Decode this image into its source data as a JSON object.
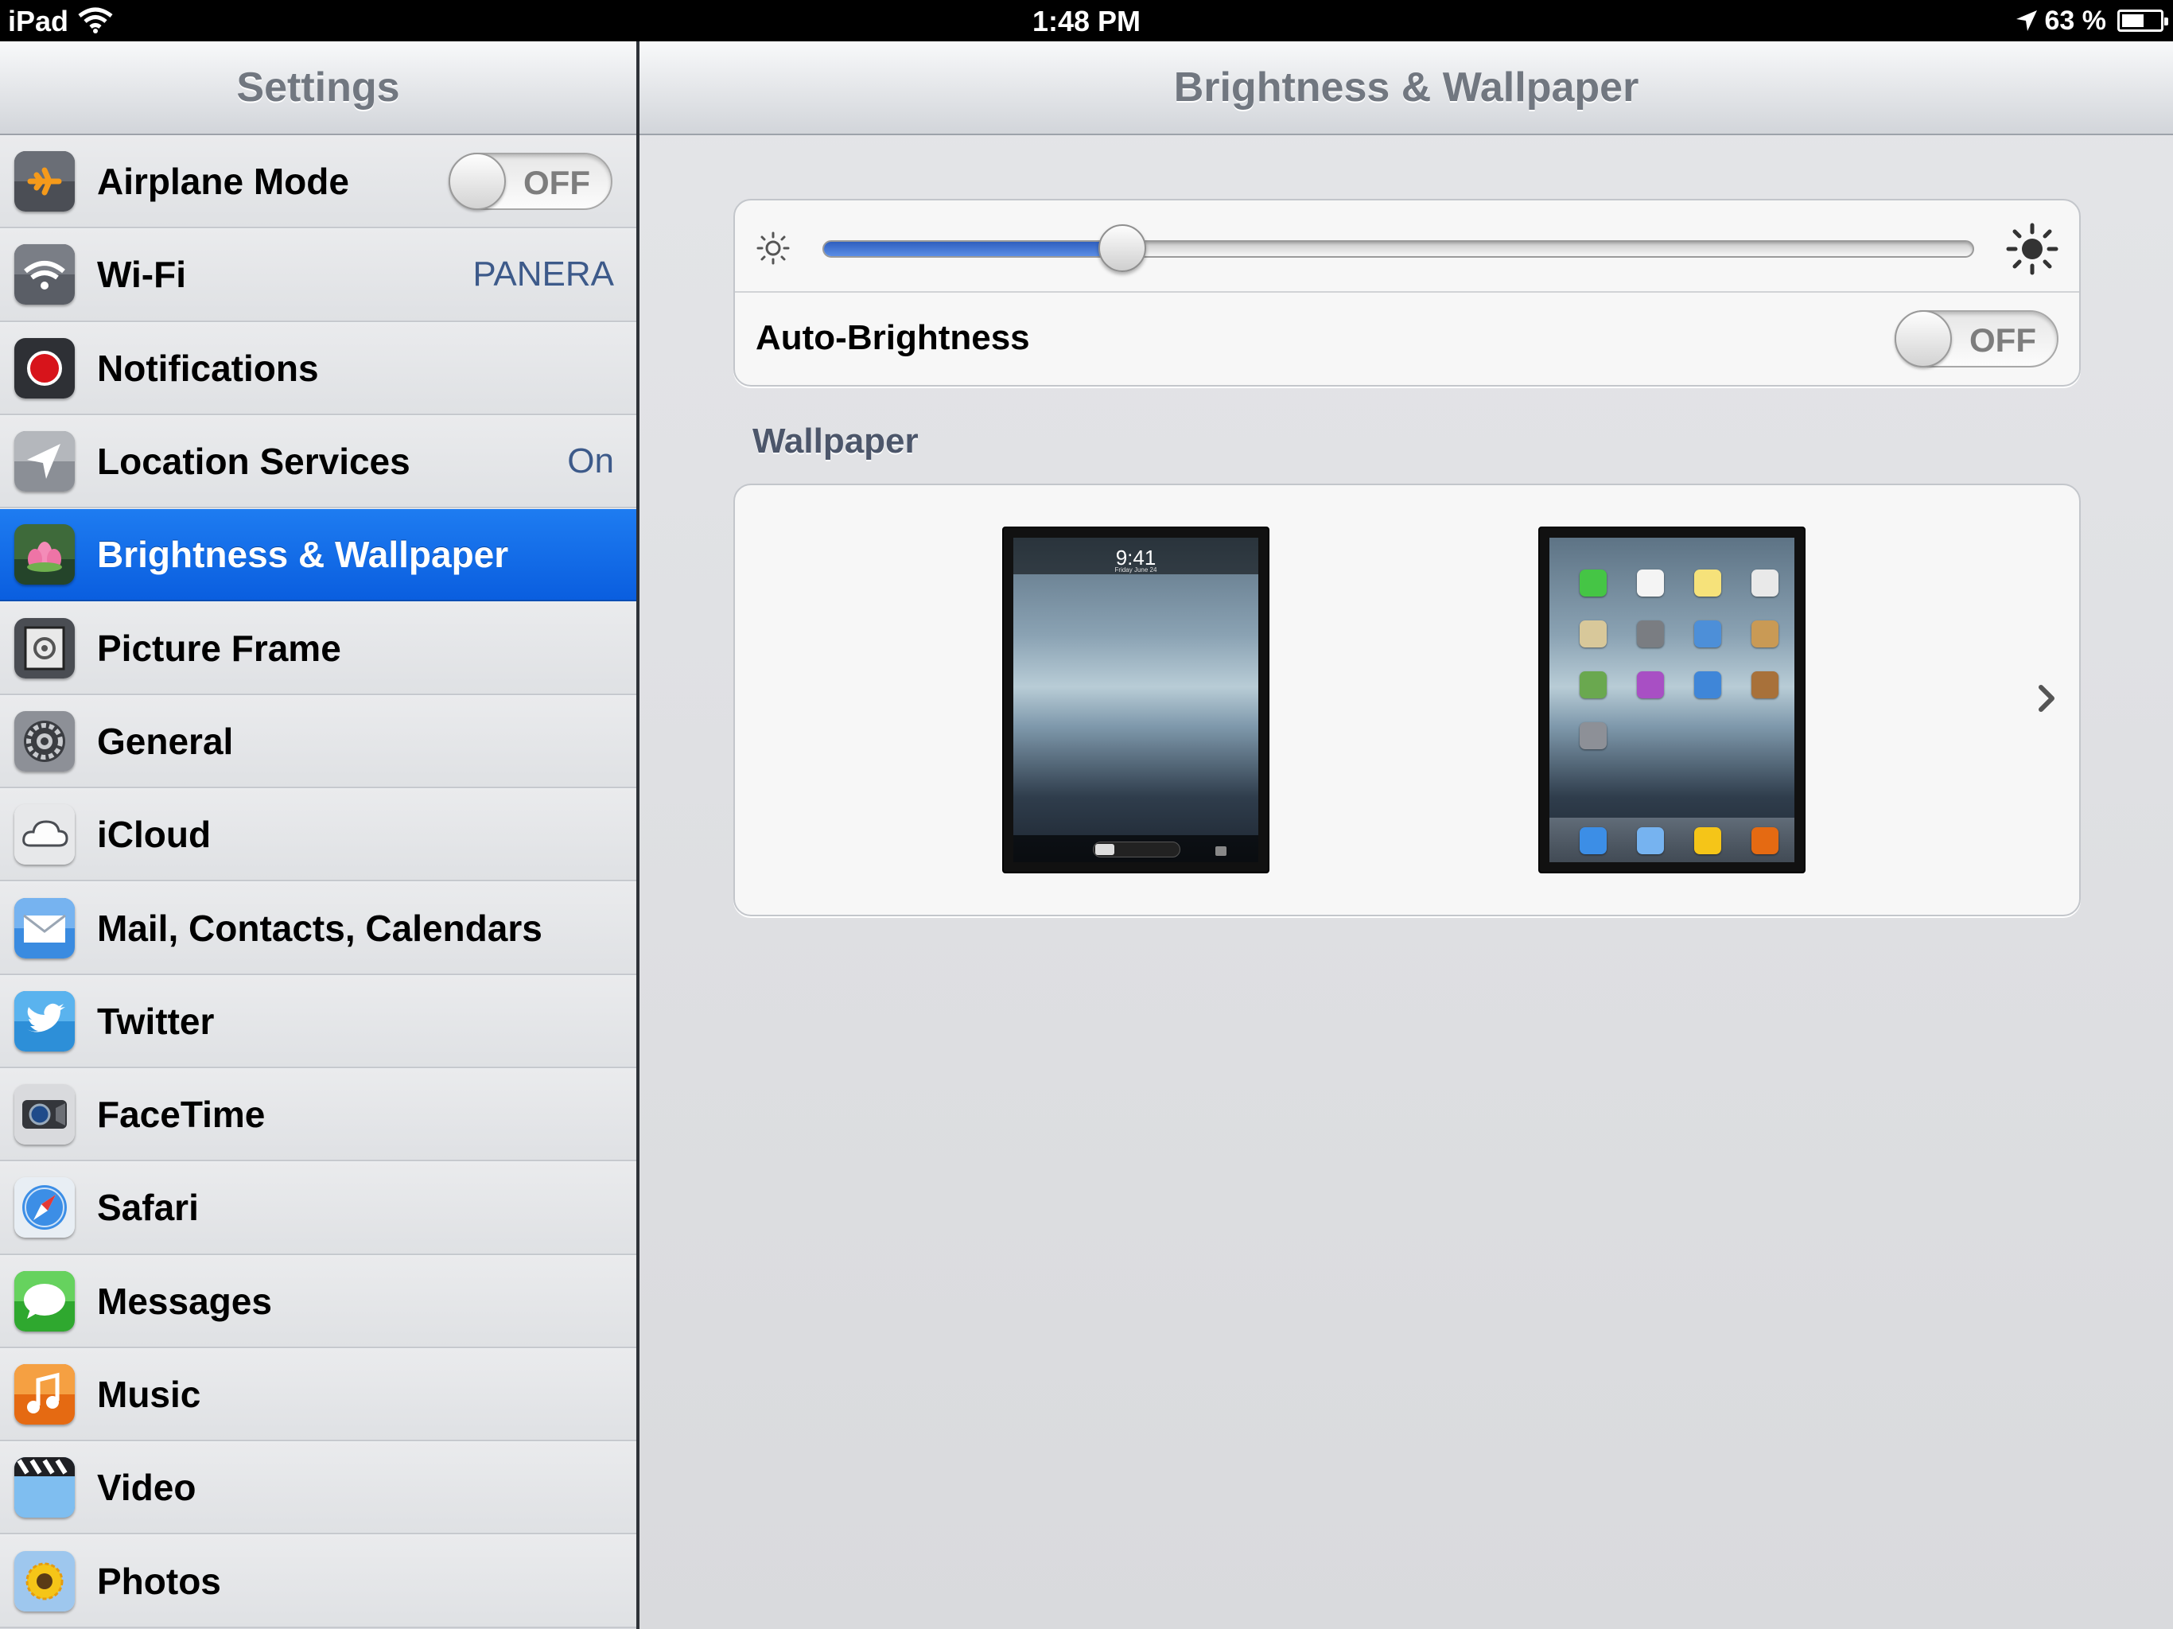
{
  "status_bar": {
    "carrier": "iPad",
    "time": "1:48 PM",
    "battery_percent_label": "63 %",
    "battery_level": 0.63,
    "icons": [
      "wifi-icon",
      "location-arrow-icon",
      "battery-icon"
    ]
  },
  "sidebar": {
    "title": "Settings",
    "items": [
      {
        "label": "Airplane Mode",
        "icon": "airplane-icon",
        "toggle": "OFF",
        "value": null
      },
      {
        "label": "Wi-Fi",
        "icon": "wifi-icon",
        "value": "PANERA"
      },
      {
        "label": "Notifications",
        "icon": "notifications-icon",
        "value": null
      },
      {
        "label": "Location Services",
        "icon": "location-icon",
        "value": "On"
      },
      {
        "label": "Brightness & Wallpaper",
        "icon": "brightness-wallpaper-icon",
        "value": null,
        "selected": true
      },
      {
        "label": "Picture Frame",
        "icon": "picture-frame-icon",
        "value": null
      },
      {
        "label": "General",
        "icon": "gear-icon",
        "value": null
      },
      {
        "label": "iCloud",
        "icon": "icloud-icon",
        "value": null
      },
      {
        "label": "Mail, Contacts, Calendars",
        "icon": "mail-icon",
        "value": null
      },
      {
        "label": "Twitter",
        "icon": "twitter-icon",
        "value": null
      },
      {
        "label": "FaceTime",
        "icon": "facetime-icon",
        "value": null
      },
      {
        "label": "Safari",
        "icon": "safari-icon",
        "value": null
      },
      {
        "label": "Messages",
        "icon": "messages-icon",
        "value": null
      },
      {
        "label": "Music",
        "icon": "music-icon",
        "value": null
      },
      {
        "label": "Video",
        "icon": "video-icon",
        "value": null
      },
      {
        "label": "Photos",
        "icon": "photos-icon",
        "value": null
      }
    ]
  },
  "detail": {
    "title": "Brightness & Wallpaper",
    "brightness_level": 0.26,
    "auto_brightness": {
      "label": "Auto-Brightness",
      "toggle": "OFF"
    },
    "wallpaper": {
      "header": "Wallpaper",
      "lock_screen_time": "9:41",
      "lock_screen_date": "Friday June 24"
    }
  },
  "colors": {
    "selection_blue": "#0d63e3",
    "value_blue": "#3d5a8a",
    "slider_fill": "#3f72d2"
  }
}
